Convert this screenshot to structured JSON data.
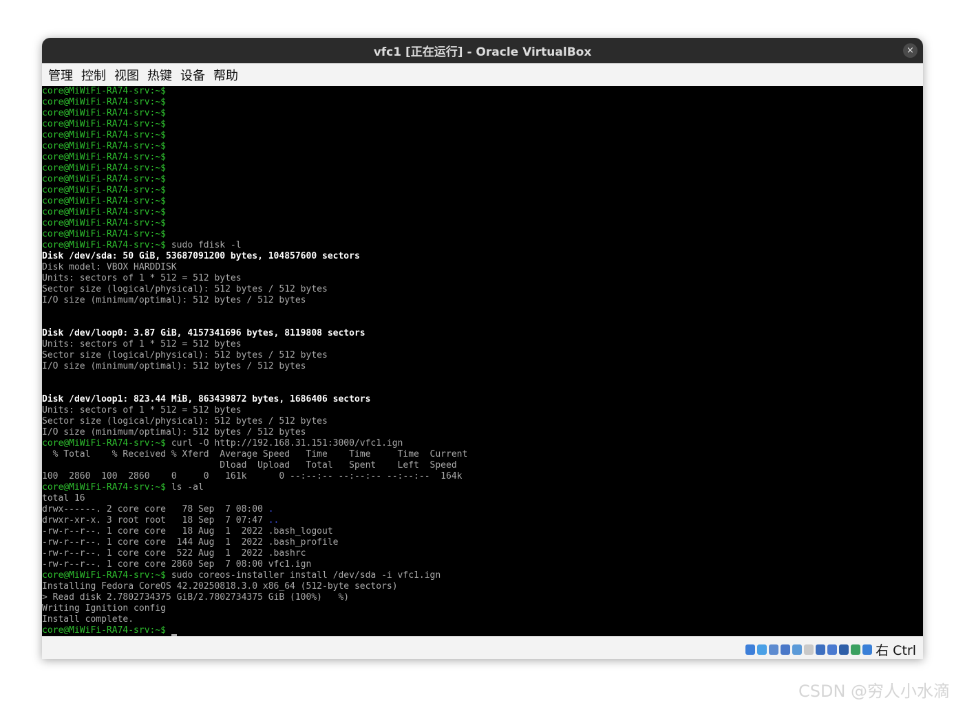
{
  "window": {
    "title": "vfc1 [正在运行] - Oracle VirtualBox",
    "close_symbol": "×"
  },
  "menu": [
    "管理",
    "控制",
    "视图",
    "热键",
    "设备",
    "帮助"
  ],
  "terminal": {
    "prompt": "core@MiWiFi-RA74-srv:~$",
    "lines": [
      {
        "type": "prompt",
        "cmd": ""
      },
      {
        "type": "prompt",
        "cmd": ""
      },
      {
        "type": "prompt",
        "cmd": ""
      },
      {
        "type": "prompt",
        "cmd": ""
      },
      {
        "type": "prompt",
        "cmd": ""
      },
      {
        "type": "prompt",
        "cmd": ""
      },
      {
        "type": "prompt",
        "cmd": ""
      },
      {
        "type": "prompt",
        "cmd": ""
      },
      {
        "type": "prompt",
        "cmd": ""
      },
      {
        "type": "prompt",
        "cmd": ""
      },
      {
        "type": "prompt",
        "cmd": ""
      },
      {
        "type": "prompt",
        "cmd": ""
      },
      {
        "type": "prompt",
        "cmd": ""
      },
      {
        "type": "prompt",
        "cmd": ""
      },
      {
        "type": "prompt",
        "cmd": " sudo fdisk -l"
      },
      {
        "type": "bright",
        "text": "Disk /dev/sda: 50 GiB, 53687091200 bytes, 104857600 sectors"
      },
      {
        "type": "out",
        "text": "Disk model: VBOX HARDDISK"
      },
      {
        "type": "out",
        "text": "Units: sectors of 1 * 512 = 512 bytes"
      },
      {
        "type": "out",
        "text": "Sector size (logical/physical): 512 bytes / 512 bytes"
      },
      {
        "type": "out",
        "text": "I/O size (minimum/optimal): 512 bytes / 512 bytes"
      },
      {
        "type": "out",
        "text": ""
      },
      {
        "type": "out",
        "text": ""
      },
      {
        "type": "bright",
        "text": "Disk /dev/loop0: 3.87 GiB, 4157341696 bytes, 8119808 sectors"
      },
      {
        "type": "out",
        "text": "Units: sectors of 1 * 512 = 512 bytes"
      },
      {
        "type": "out",
        "text": "Sector size (logical/physical): 512 bytes / 512 bytes"
      },
      {
        "type": "out",
        "text": "I/O size (minimum/optimal): 512 bytes / 512 bytes"
      },
      {
        "type": "out",
        "text": ""
      },
      {
        "type": "out",
        "text": ""
      },
      {
        "type": "bright",
        "text": "Disk /dev/loop1: 823.44 MiB, 863439872 bytes, 1686406 sectors"
      },
      {
        "type": "out",
        "text": "Units: sectors of 1 * 512 = 512 bytes"
      },
      {
        "type": "out",
        "text": "Sector size (logical/physical): 512 bytes / 512 bytes"
      },
      {
        "type": "out",
        "text": "I/O size (minimum/optimal): 512 bytes / 512 bytes"
      },
      {
        "type": "prompt",
        "cmd": " curl -O http://192.168.31.151:3000/vfc1.ign"
      },
      {
        "type": "out",
        "text": "  % Total    % Received % Xferd  Average Speed   Time    Time     Time  Current"
      },
      {
        "type": "out",
        "text": "                                 Dload  Upload   Total   Spent    Left  Speed"
      },
      {
        "type": "out",
        "text": "100  2860  100  2860    0     0   161k      0 --:--:-- --:--:-- --:--:--  164k"
      },
      {
        "type": "prompt",
        "cmd": " ls -al"
      },
      {
        "type": "out",
        "text": "total 16"
      },
      {
        "type": "ls",
        "text": "drwx------. 2 core core   78 Sep  7 08:00 ",
        "name": "."
      },
      {
        "type": "ls",
        "text": "drwxr-xr-x. 3 root root   18 Sep  7 07:47 ",
        "name": ".."
      },
      {
        "type": "out",
        "text": "-rw-r--r--. 1 core core   18 Aug  1  2022 .bash_logout"
      },
      {
        "type": "out",
        "text": "-rw-r--r--. 1 core core  144 Aug  1  2022 .bash_profile"
      },
      {
        "type": "out",
        "text": "-rw-r--r--. 1 core core  522 Aug  1  2022 .bashrc"
      },
      {
        "type": "out",
        "text": "-rw-r--r--. 1 core core 2860 Sep  7 08:00 vfc1.ign"
      },
      {
        "type": "prompt",
        "cmd": " sudo coreos-installer install /dev/sda -i vfc1.ign"
      },
      {
        "type": "out",
        "text": "Installing Fedora CoreOS 42.20250818.3.0 x86_64 (512-byte sectors)"
      },
      {
        "type": "out",
        "text": "> Read disk 2.7802734375 GiB/2.7802734375 GiB (100%)   %)"
      },
      {
        "type": "out",
        "text": "Writing Ignition config"
      },
      {
        "type": "out",
        "text": "Install complete."
      },
      {
        "type": "prompt",
        "cmd": " ",
        "cursor": true
      }
    ]
  },
  "status_bar": {
    "icons": [
      {
        "name": "hard-disk-icon",
        "color": "#3d7fd9"
      },
      {
        "name": "optical-drive-icon",
        "color": "#4aa0e6"
      },
      {
        "name": "audio-icon",
        "color": "#5d8bd0"
      },
      {
        "name": "network-icon",
        "color": "#4a78c8"
      },
      {
        "name": "usb-icon",
        "color": "#5b9ad8"
      },
      {
        "name": "shared-folders-icon",
        "color": "#c9c9c9"
      },
      {
        "name": "display-icon",
        "color": "#3d6fc0"
      },
      {
        "name": "recording-icon",
        "color": "#4a7ad0"
      },
      {
        "name": "cpu-icon",
        "color": "#2f5fa8"
      },
      {
        "name": "guest-additions-icon",
        "color": "#3aa060"
      },
      {
        "name": "keyboard-capture-icon",
        "color": "#3a80d8"
      }
    ],
    "host_key": "右 Ctrl"
  },
  "watermark": "CSDN @穷人小水滴"
}
